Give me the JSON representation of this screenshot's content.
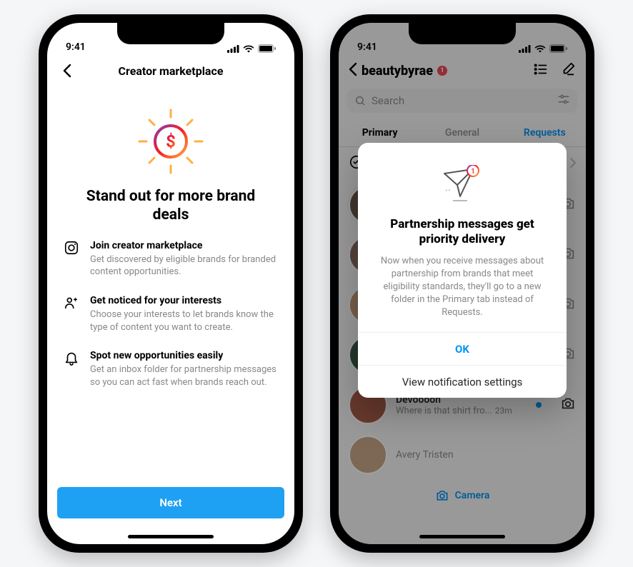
{
  "status": {
    "time": "9:41"
  },
  "phone1": {
    "nav_title": "Creator marketplace",
    "hero_title": "Stand out for more brand deals",
    "bullets": [
      {
        "icon": "instagram-icon",
        "title": "Join creator marketplace",
        "desc": "Get discovered by eligible brands for branded content opportunities."
      },
      {
        "icon": "person-sparkle-icon",
        "title": "Get noticed for your interests",
        "desc": "Choose your interests to let brands know the type of content you want to create."
      },
      {
        "icon": "bell-icon",
        "title": "Spot new opportunities easily",
        "desc": "Get an inbox folder for partnership messages so you can act fast when brands reach out."
      }
    ],
    "next_label": "Next"
  },
  "phone2": {
    "username": "beautybyrae",
    "badge_count": "1",
    "search_placeholder": "Search",
    "tabs": {
      "primary": "Primary",
      "general": "General",
      "requests": "Requests"
    },
    "filter_label": "Filter",
    "camera_label": "Camera",
    "dm_rows": [
      {
        "name": "Devoooon",
        "sub": "Where is that shirt fro...",
        "time": "23m"
      },
      {
        "name": "Avery Tristen",
        "sub": ""
      }
    ],
    "modal": {
      "title": "Partnership messages get priority delivery",
      "text": "Now when you receive messages about partnership from brands that meet eligibility standards, they'll go to a new folder in the Primary tab instead of Requests.",
      "ok": "OK",
      "settings": "View notification settings",
      "badge": "1"
    }
  }
}
